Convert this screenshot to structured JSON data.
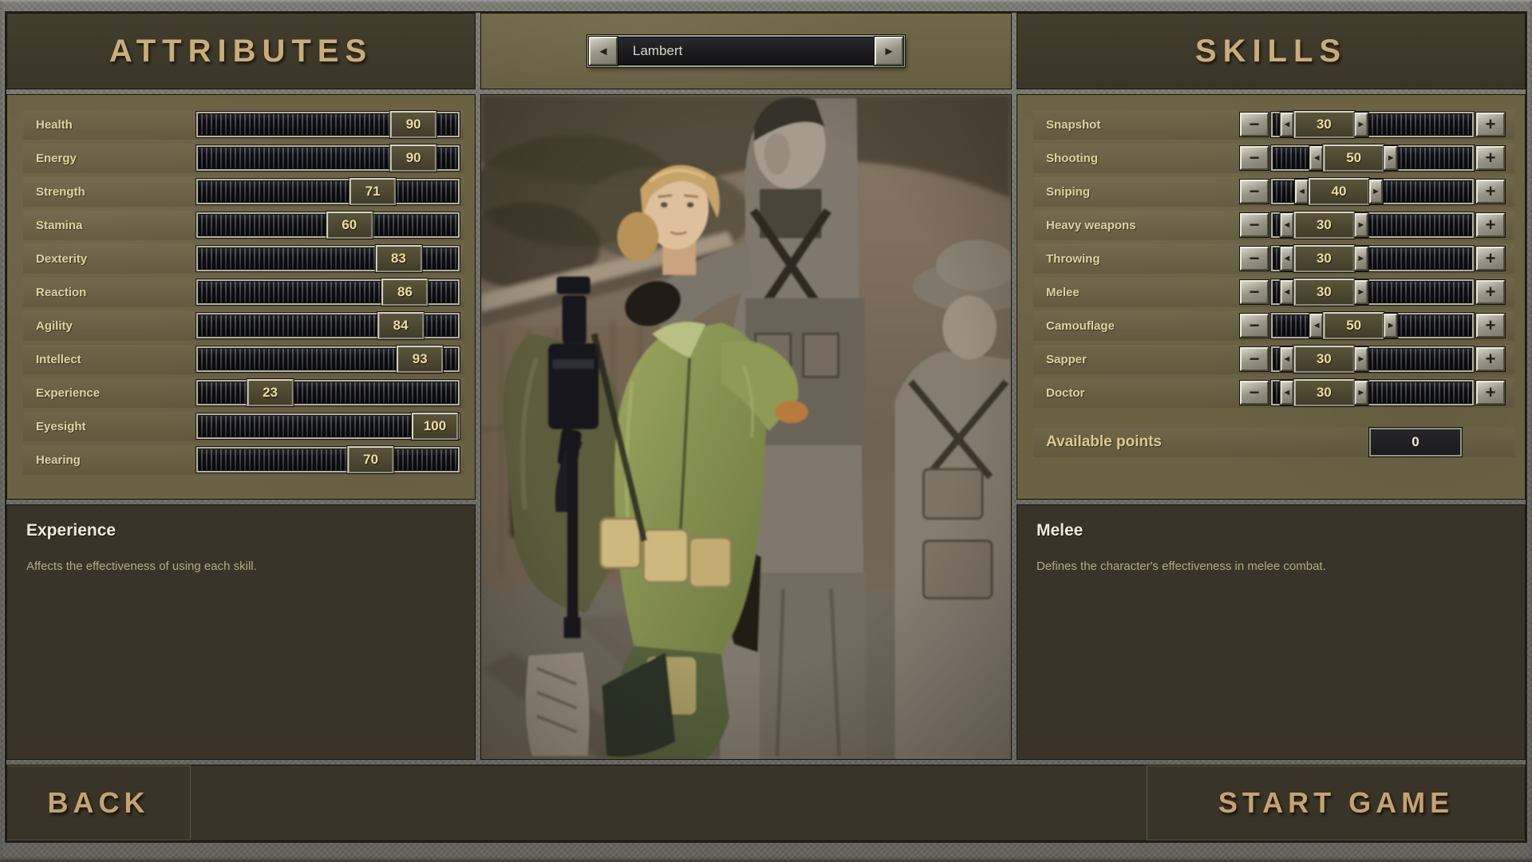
{
  "header": {
    "attributes_title": "ATTRIBUTES",
    "skills_title": "SKILLS"
  },
  "character": {
    "name": "Lambert",
    "portrait_alt": "Blonde female soldier in green fatigues with submachine gun, flanked by two grayscale male soldiers in front of a sepia village hut"
  },
  "attributes": {
    "rows": [
      {
        "label": "Health",
        "value": 90
      },
      {
        "label": "Energy",
        "value": 90
      },
      {
        "label": "Strength",
        "value": 71
      },
      {
        "label": "Stamina",
        "value": 60
      },
      {
        "label": "Dexterity",
        "value": 83
      },
      {
        "label": "Reaction",
        "value": 86
      },
      {
        "label": "Agility",
        "value": 84
      },
      {
        "label": "Intellect",
        "value": 93
      },
      {
        "label": "Experience",
        "value": 23
      },
      {
        "label": "Eyesight",
        "value": 100
      },
      {
        "label": "Hearing",
        "value": 70
      }
    ]
  },
  "skills": {
    "rows": [
      {
        "label": "Snapshot",
        "value": 30
      },
      {
        "label": "Shooting",
        "value": 50
      },
      {
        "label": "Sniping",
        "value": 40
      },
      {
        "label": "Heavy weapons",
        "value": 30
      },
      {
        "label": "Throwing",
        "value": 30
      },
      {
        "label": "Melee",
        "value": 30
      },
      {
        "label": "Camouflage",
        "value": 50
      },
      {
        "label": "Sapper",
        "value": 30
      },
      {
        "label": "Doctor",
        "value": 30
      }
    ],
    "available_points_label": "Available points",
    "available_points_value": 0
  },
  "descriptions": {
    "left": {
      "title": "Experience",
      "text": "Affects the effectiveness of using each skill."
    },
    "right": {
      "title": "Melee",
      "text": "Defines the character's effectiveness in melee combat."
    }
  },
  "footer": {
    "back_label": "BACK",
    "start_label": "START GAME"
  },
  "icons": {
    "prev": "◄",
    "next": "►",
    "minus": "−",
    "plus": "+",
    "thumb_left": "◄",
    "thumb_right": "►"
  },
  "colors": {
    "panel_olive": "#6b6244",
    "panel_dark": "#3d3828",
    "frame_gray": "#74736c",
    "title_tan": "#c8ad7c",
    "label_khaki": "#ded2a2",
    "value_tan": "#ecdba4",
    "desc_heading": "#f0ead8",
    "desc_text": "#b4a985",
    "footer_text": "#c3a273"
  }
}
